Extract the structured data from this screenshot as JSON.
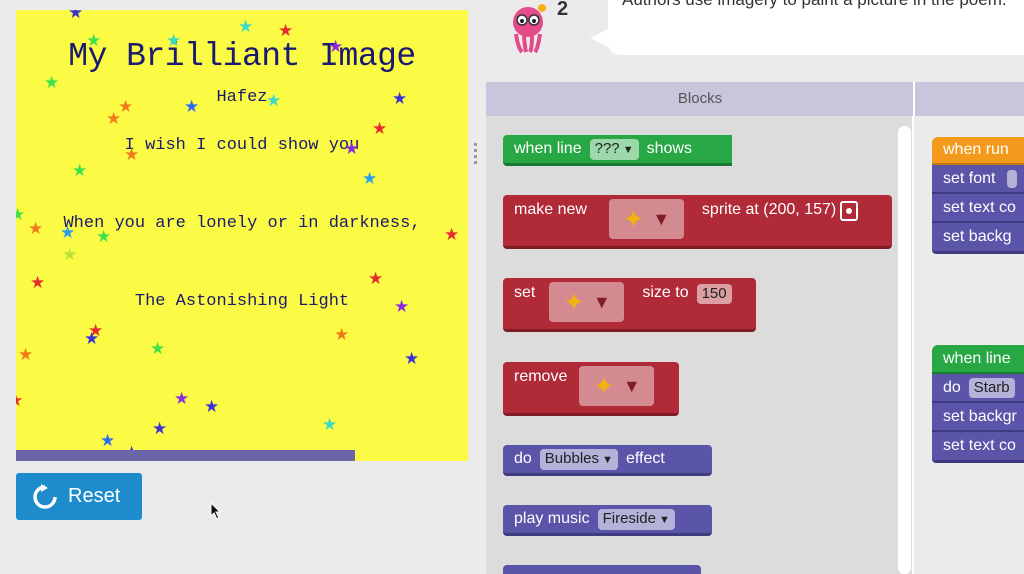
{
  "stage": {
    "title": "My Brilliant Image",
    "author": "Hafez",
    "lines": [
      "I wish I could show you",
      "When you are lonely or in darkness,",
      "The Astonishing Light"
    ],
    "progress_fraction": 0.75
  },
  "reset_label": "Reset",
  "instructions": {
    "level_number": "2",
    "text": "Authors use imagery to paint a picture in the poem."
  },
  "toolbox": {
    "header": "Blocks",
    "when_line": {
      "prefix": "when line",
      "value": "???",
      "suffix": "shows"
    },
    "make_new": {
      "prefix": "make new",
      "suffix": "sprite at (200, 157)"
    },
    "set_size": {
      "prefix": "set",
      "middle": "size to",
      "value": "150"
    },
    "remove": {
      "label": "remove"
    },
    "do_effect": {
      "prefix": "do",
      "value": "Bubbles",
      "suffix": "effect"
    },
    "play_music": {
      "prefix": "play music",
      "value": "Fireside"
    }
  },
  "workspace": {
    "when_run": "when run",
    "run_stack": [
      "set font",
      "set text co",
      "set backg"
    ],
    "when_line": "when line",
    "do_label": "do",
    "do_value": "Starb",
    "line_stack": [
      "set backgr",
      "set text co"
    ]
  },
  "colors": {
    "stage_bg": "#fbfb46",
    "text": "#1a1a6e",
    "event_green": "#27a844",
    "sprite_red": "#b02a37",
    "world_purple": "#5a55a8",
    "run_orange": "#f39a1c",
    "reset_blue": "#1e8ccc"
  },
  "icons": {
    "reset": "refresh-icon",
    "avatar": "octopus-avatar-icon",
    "sprite": "sparkle-icon",
    "location": "location-icon",
    "cursor": "mouse-pointer-icon"
  }
}
